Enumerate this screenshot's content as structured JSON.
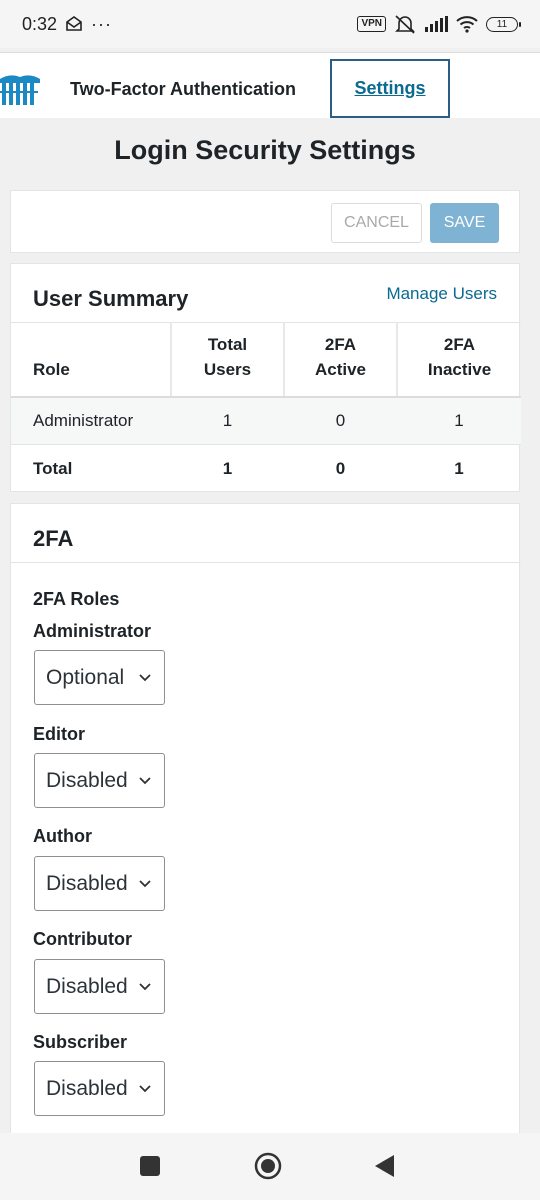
{
  "status_bar": {
    "time": "0:32",
    "dots": "···",
    "vpn": "VPN",
    "battery": "11"
  },
  "header": {
    "tab_2fa": "Two-Factor Authentication",
    "tab_settings": "Settings"
  },
  "page": {
    "title": "Login Security Settings"
  },
  "actions": {
    "cancel": "CANCEL",
    "save": "SAVE"
  },
  "user_summary": {
    "title": "User Summary",
    "manage_link": "Manage Users",
    "columns": {
      "role": "Role",
      "total_1": "Total",
      "total_2": "Users",
      "active_1": "2FA",
      "active_2": "Active",
      "inactive_1": "2FA",
      "inactive_2": "Inactive"
    },
    "rows": [
      {
        "role": "Administrator",
        "total": "1",
        "active": "0",
        "inactive": "1"
      },
      {
        "role": "Total",
        "total": "1",
        "active": "0",
        "inactive": "1"
      }
    ]
  },
  "twofa": {
    "title": "2FA",
    "roles_heading": "2FA Roles",
    "roles": [
      {
        "label": "Administrator",
        "value": "Optional"
      },
      {
        "label": "Editor",
        "value": "Disabled"
      },
      {
        "label": "Author",
        "value": "Disabled"
      },
      {
        "label": "Contributor",
        "value": "Disabled"
      },
      {
        "label": "Subscriber",
        "value": "Disabled"
      }
    ]
  },
  "colors": {
    "accent_link": "#0a6a8f",
    "save_button": "#7fb3d3",
    "tab_border": "#2c5d85",
    "background": "#f0f0f1"
  }
}
